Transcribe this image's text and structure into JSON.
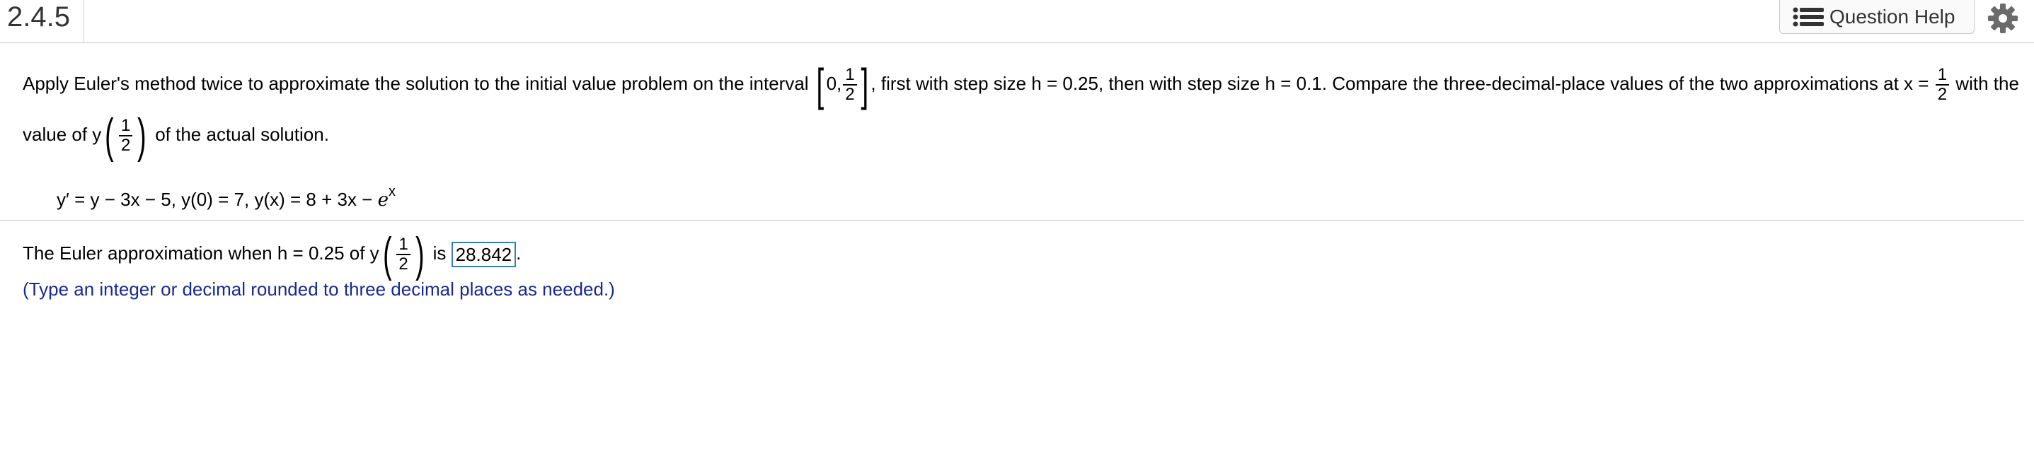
{
  "header": {
    "question_number": "2.4.5",
    "help_label": "Question Help"
  },
  "problem": {
    "line1_a": "Apply Euler's method twice to approximate the solution to the initial value problem on the interval",
    "interval_start": "0,",
    "interval_num": "1",
    "interval_den": "2",
    "line1_b": ", first with step size h = 0.25, then with step size h = 0.1. Compare the three-decimal-place values of the two approximations at x =",
    "x_num": "1",
    "x_den": "2",
    "line1_c": "with the",
    "line2_a": "value of y",
    "y_num": "1",
    "y_den": "2",
    "line2_b": "of the actual solution."
  },
  "equation": {
    "text": "y′ = y − 3x − 5, y(0) = 7, y(x) = 8 + 3x −",
    "e": "e",
    "exp": "x"
  },
  "answer": {
    "prefix": "The Euler approximation when h = 0.25 of y",
    "num": "1",
    "den": "2",
    "is": "is",
    "value": "28.842",
    "suffix": ".",
    "hint": "(Type an integer or decimal rounded to three decimal places as needed.)"
  },
  "colors": {
    "hint": "#1a2a8c",
    "answer_border": "#3b7fb0"
  }
}
